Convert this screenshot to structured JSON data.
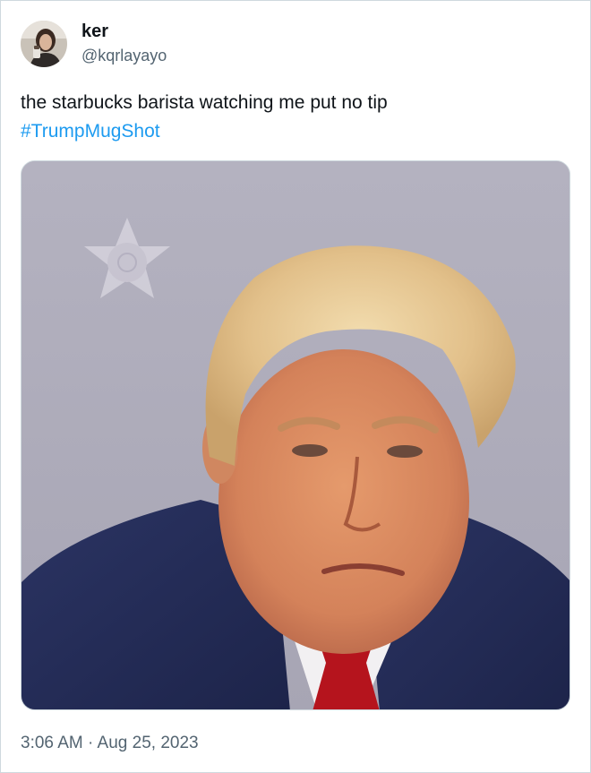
{
  "tweet": {
    "author": {
      "display_name": "ker",
      "handle": "@kqrlayayo",
      "avatar_icon": "user-avatar-icon"
    },
    "text": "the starbucks barista watching me put no tip",
    "hashtag": "#TrumpMugShot",
    "media": {
      "kind": "photo",
      "icon": "sheriff-badge-icon"
    },
    "timestamp": "3:06 AM · Aug 25, 2023"
  },
  "colors": {
    "text_primary": "#0f1419",
    "text_secondary": "#536471",
    "link": "#1d9bf0",
    "border": "#cfd9de",
    "photo_background": "#b1afbc"
  }
}
